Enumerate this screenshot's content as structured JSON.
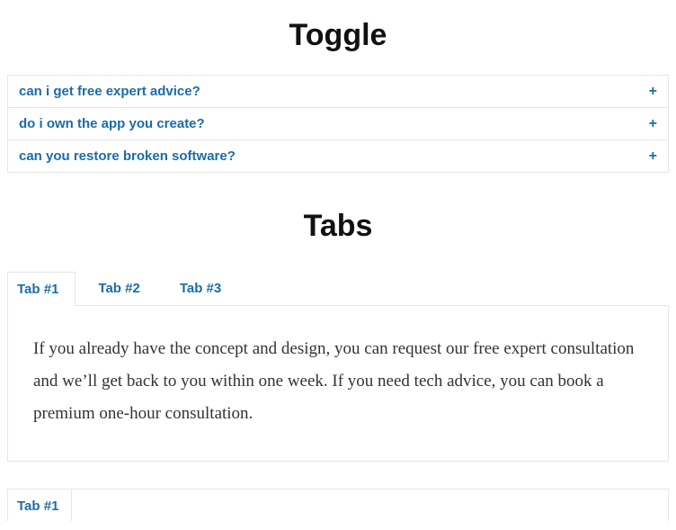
{
  "toggle": {
    "heading": "Toggle",
    "items": [
      {
        "question": "can i get free expert advice?"
      },
      {
        "question": "do i own the app you create?"
      },
      {
        "question": "can you restore broken software?"
      }
    ]
  },
  "tabs": {
    "heading": "Tabs",
    "items": [
      {
        "label": "Tab #1"
      },
      {
        "label": "Tab #2"
      },
      {
        "label": "Tab #3"
      }
    ],
    "panel_content": "If you already have the concept and design, you can request our free expert consultation and we’ll get back to you within one week. If you need tech advice, you can book a premium one-hour consultation."
  },
  "tabs2": {
    "items": [
      {
        "label": "Tab #1"
      }
    ]
  },
  "icons": {
    "plus": "+"
  }
}
